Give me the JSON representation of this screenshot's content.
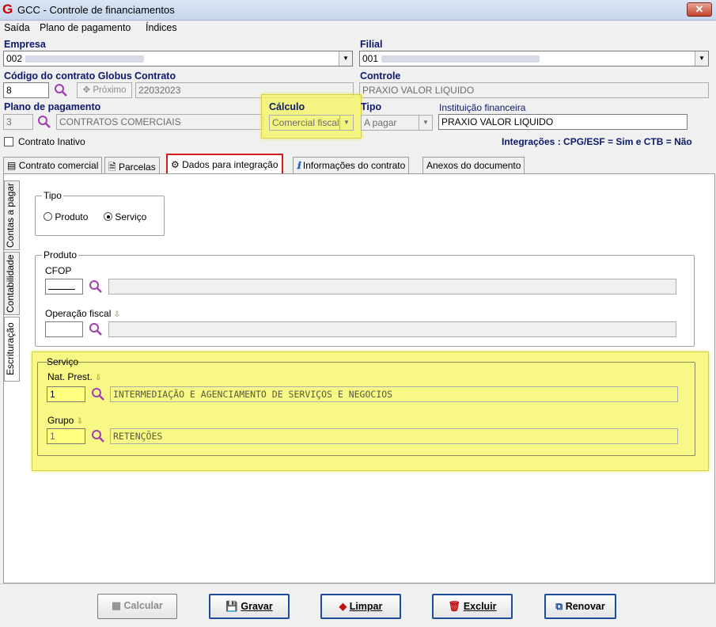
{
  "window": {
    "title": "GCC - Controle de financiamentos",
    "close_label": "✕"
  },
  "menu": [
    "Saída",
    "Plano de pagamento",
    "Índices"
  ],
  "empresa": {
    "label": "Empresa",
    "value": "002"
  },
  "filial": {
    "label": "Filial",
    "value": "001"
  },
  "codigo": {
    "label": "Código do contrato Globus",
    "value": "8",
    "next_label": "Próximo"
  },
  "contrato": {
    "label": "Contrato",
    "value": "22032023"
  },
  "controle": {
    "label": "Controle",
    "value": "PRAXIO VALOR LIQUIDO"
  },
  "plano": {
    "label": "Plano de pagamento",
    "code": "3",
    "desc": "CONTRATOS COMERCIAIS"
  },
  "calculo": {
    "label": "Cálculo",
    "value": "Comercial fiscal"
  },
  "tipo_top": {
    "label": "Tipo",
    "value": "A pagar"
  },
  "instituicao": {
    "label": "Instituição financeira",
    "value": "PRAXIO VALOR LIQUIDO"
  },
  "inativo": {
    "label": "Contrato Inativo"
  },
  "integracoes": "Integrações : CPG/ESF = Sim e CTB = Não",
  "tabs": [
    "Contrato comercial",
    "Parcelas",
    "Dados para integração",
    "Informações do contrato",
    "Anexos do documento"
  ],
  "vtabs": [
    "Contas a pagar",
    "Contabilidade",
    "Escrituração"
  ],
  "tipo_group": {
    "title": "Tipo",
    "opt1": "Produto",
    "opt2": "Serviço",
    "selected": "Serviço"
  },
  "produto": {
    "title": "Produto",
    "cfop_label": "CFOP",
    "opfiscal_label": "Operação fiscal"
  },
  "servico": {
    "title": "Serviço",
    "nat_label": "Nat. Prest.",
    "nat_code": "1",
    "nat_desc": "INTERMEDIAÇÃO E AGENCIAMENTO DE SERVIÇOS E NEGOCIOS",
    "grupo_label": "Grupo",
    "grupo_code": "1",
    "grupo_desc": "RETENÇÕES"
  },
  "buttons": {
    "calcular": "Calcular",
    "gravar": "Gravar",
    "limpar": "Limpar",
    "excluir": "Excluir",
    "renovar": "Renovar"
  },
  "colors": {
    "highlight": "#f5f55f",
    "label_blue": "#0c1a6e",
    "red_box": "#d61d1d",
    "search": "#a040b0"
  }
}
